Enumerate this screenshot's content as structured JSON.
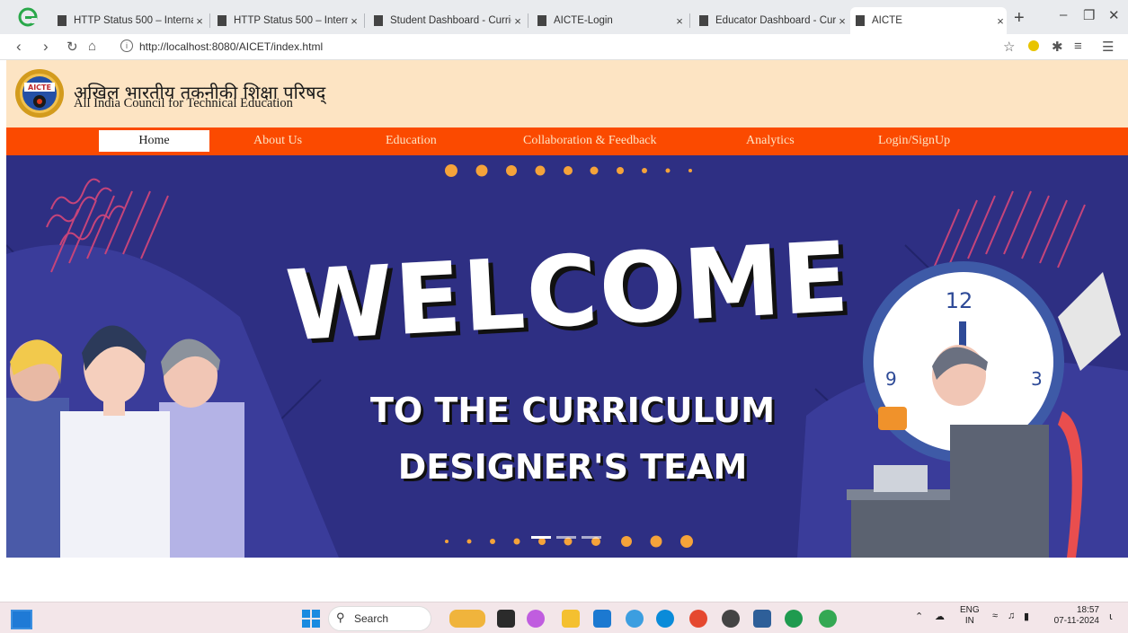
{
  "browser": {
    "tabs": [
      {
        "label": "HTTP Status 500 – Internal S",
        "active": false
      },
      {
        "label": "HTTP Status 500 – Internal S",
        "active": false
      },
      {
        "label": "Student Dashboard - Curric",
        "active": false
      },
      {
        "label": "AICTE-Login",
        "active": false
      },
      {
        "label": "Educator Dashboard - Curri",
        "active": false
      },
      {
        "label": "AICTE",
        "active": true
      }
    ],
    "close_glyph": "×",
    "new_tab_glyph": "+",
    "url": "http://localhost:8080/AICET/index.html"
  },
  "site": {
    "logo_text": "AICTE",
    "title_hindi": "अखिल भारतीय तकनीकी शिक्षा परिषद्",
    "title_english": "All India Council for Technical Education",
    "nav": {
      "home": "Home",
      "about": "About Us",
      "education": "Education",
      "collaboration": "Collaboration & Feedback",
      "analytics": "Analytics",
      "login": "Login/SignUp"
    },
    "banner": {
      "headline": "WELCOME",
      "subline1": "TO THE CURRICULUM",
      "subline2": "DESIGNER'S TEAM",
      "clock_numbers": [
        "12",
        "9",
        "3"
      ]
    }
  },
  "taskbar": {
    "search_label": "Search",
    "lang_top": "ENG",
    "lang_bottom": "IN",
    "time": "18:57",
    "date": "07-11-2024"
  },
  "colors": {
    "header_bg": "#fde4c3",
    "nav_bg": "#fb4a00",
    "banner_bg": "#2e2f83",
    "accent_orange": "#f5a33a"
  }
}
